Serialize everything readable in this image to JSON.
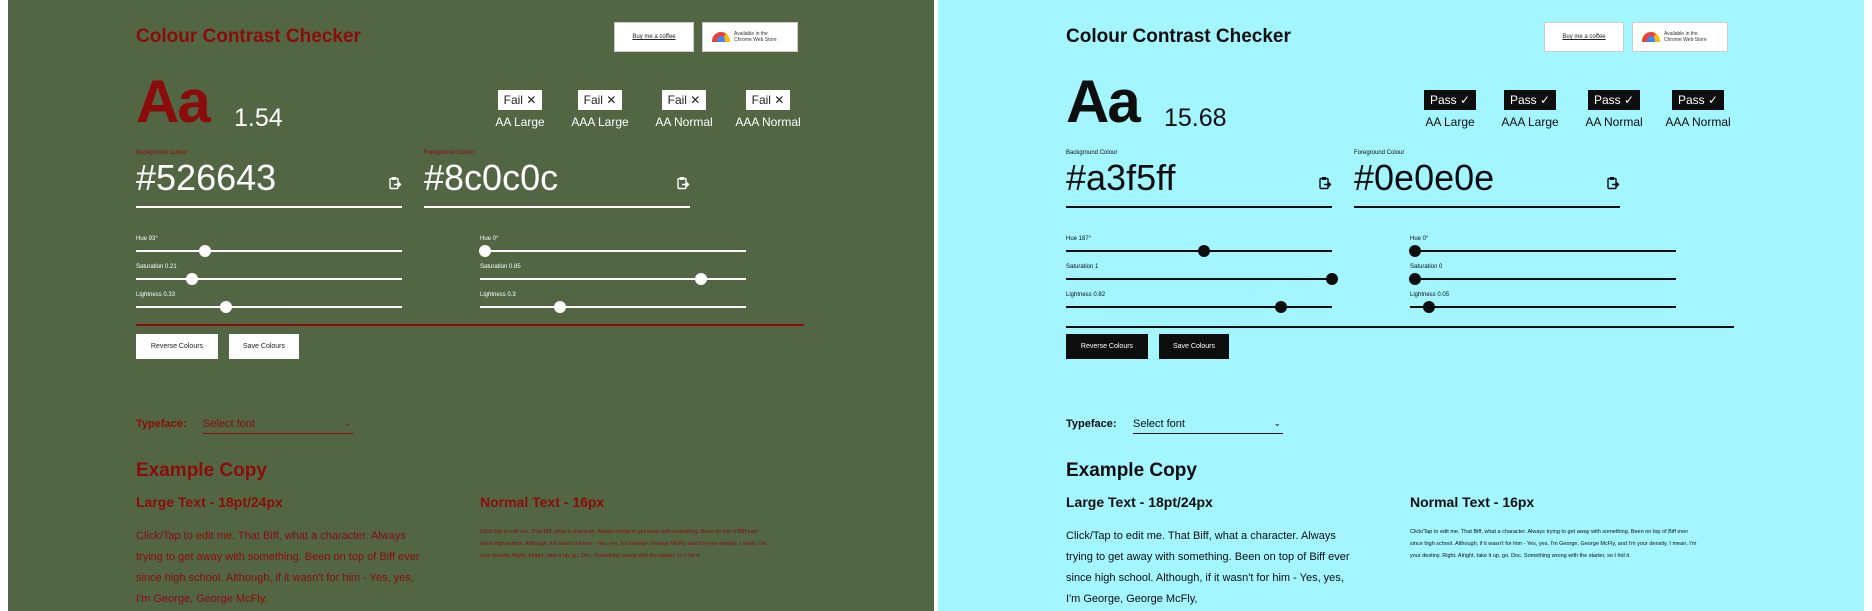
{
  "panels": [
    {
      "colors": {
        "background": "#526643",
        "foreground": "#8c0c0c",
        "subtle": "#ffffff",
        "pill_bg": "#ffffff",
        "pill_fg": "#222222",
        "button_bg": "#ffffff",
        "button_fg": "#222222"
      },
      "title": "Colour Contrast Checker",
      "badges": {
        "coffee": "Buy me a coffee",
        "chrome": "Available in the\nChrome Web Store"
      },
      "sample": "Aa",
      "ratio": "1.54",
      "results": [
        {
          "label": "AA Large",
          "status": "Fail ✕"
        },
        {
          "label": "AAA Large",
          "status": "Fail ✕"
        },
        {
          "label": "AA Normal",
          "status": "Fail ✕"
        },
        {
          "label": "AAA Normal",
          "status": "Fail ✕"
        }
      ],
      "background_field": {
        "label": "Background Colour",
        "value": "#526643"
      },
      "foreground_field": {
        "label": "Foreground Colour",
        "value": "#8c0c0c"
      },
      "bg_sliders": [
        {
          "label": "Hue 93°",
          "value": 0.26
        },
        {
          "label": "Saturation 0.21",
          "value": 0.21
        },
        {
          "label": "Lightness 0.33",
          "value": 0.34
        }
      ],
      "fg_sliders": [
        {
          "label": "Hue 0°",
          "value": 0.02
        },
        {
          "label": "Saturation 0.85",
          "value": 0.83
        },
        {
          "label": "Lightness 0.3",
          "value": 0.3
        }
      ],
      "buttons": {
        "reverse": "Reverse Colours",
        "save": "Save Colours"
      },
      "typeface": {
        "label": "Typeface:",
        "select": "Select font"
      },
      "example": {
        "title": "Example Copy",
        "large_heading": "Large Text - 18pt/24px",
        "normal_heading": "Normal Text - 16px",
        "large_copy": "Click/Tap to edit me. That Biff, what a character. Always trying to get away with something. Been on top of Biff ever since high school. Although, if it wasn't for him - Yes, yes, I'm George, George McFly,",
        "normal_copy": "Click/Tap to edit me. That Biff, what a character. Always trying to get away with something. Been on top of Biff ever since high school. Although, if it wasn't for him - Yes, yes, I'm George, George McFly, and I'm your density. I mean, I'm your destiny. Right. Alright, take it up, go. Doc. Something wrong with the starter, so I hid it."
      }
    },
    {
      "colors": {
        "background": "#a3f5ff",
        "foreground": "#0e0e0e",
        "subtle": "#0e0e0e",
        "pill_bg": "#0e0e0e",
        "pill_fg": "#ffffff",
        "button_bg": "#0e0e0e",
        "button_fg": "#ffffff"
      },
      "title": "Colour Contrast Checker",
      "badges": {
        "coffee": "Buy me a coffee",
        "chrome": "Available in the\nChrome Web Store"
      },
      "sample": "Aa",
      "ratio": "15.68",
      "results": [
        {
          "label": "AA Large",
          "status": "Pass ✓"
        },
        {
          "label": "AAA Large",
          "status": "Pass ✓"
        },
        {
          "label": "AA Normal",
          "status": "Pass ✓"
        },
        {
          "label": "AAA Normal",
          "status": "Pass ✓"
        }
      ],
      "background_field": {
        "label": "Background Colour",
        "value": "#a3f5ff"
      },
      "foreground_field": {
        "label": "Foreground Colour",
        "value": "#0e0e0e"
      },
      "bg_sliders": [
        {
          "label": "Hue 187°",
          "value": 0.52
        },
        {
          "label": "Saturation 1",
          "value": 1.0
        },
        {
          "label": "Lightness 0.82",
          "value": 0.81
        }
      ],
      "fg_sliders": [
        {
          "label": "Hue 0°",
          "value": 0.02
        },
        {
          "label": "Saturation 0",
          "value": 0.02
        },
        {
          "label": "Lightness 0.05",
          "value": 0.07
        }
      ],
      "buttons": {
        "reverse": "Reverse Colours",
        "save": "Save Colours"
      },
      "typeface": {
        "label": "Typeface:",
        "select": "Select font"
      },
      "example": {
        "title": "Example Copy",
        "large_heading": "Large Text - 18pt/24px",
        "normal_heading": "Normal Text - 16px",
        "large_copy": "Click/Tap to edit me. That Biff, what a character. Always trying to get away with something. Been on top of Biff ever since high school. Although, if it wasn't for him - Yes, yes, I'm George, George McFly,",
        "normal_copy": "Click/Tap to edit me. That Biff, what a character. Always trying to get away with something. Been on top of Biff ever since high school. Although, if it wasn't for him - Yes, yes, I'm George, George McFly, and I'm your density. I mean, I'm your destiny. Right. Alright, take it up, go. Doc. Something wrong with the starter, so I hid it."
      }
    }
  ]
}
